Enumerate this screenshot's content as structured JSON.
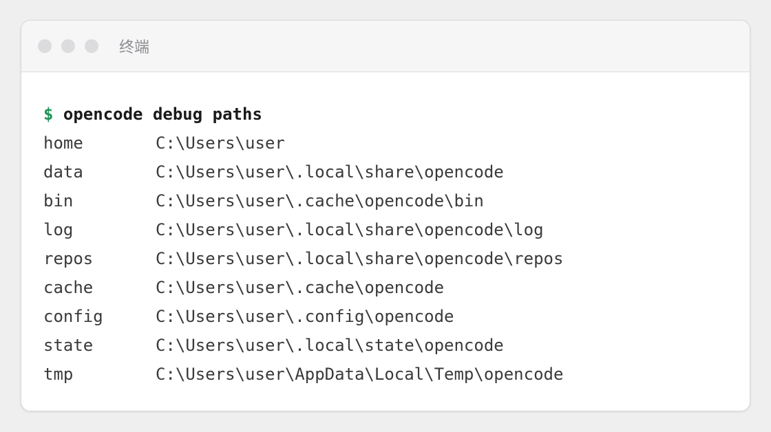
{
  "window": {
    "title": "终端"
  },
  "terminal": {
    "prompt": "$",
    "command": "opencode debug paths",
    "rows": [
      {
        "key": "home",
        "path": "C:\\Users\\user"
      },
      {
        "key": "data",
        "path": "C:\\Users\\user\\.local\\share\\opencode"
      },
      {
        "key": "bin",
        "path": "C:\\Users\\user\\.cache\\opencode\\bin"
      },
      {
        "key": "log",
        "path": "C:\\Users\\user\\.local\\share\\opencode\\log"
      },
      {
        "key": "repos",
        "path": "C:\\Users\\user\\.local\\share\\opencode\\repos"
      },
      {
        "key": "cache",
        "path": "C:\\Users\\user\\.cache\\opencode"
      },
      {
        "key": "config",
        "path": "C:\\Users\\user\\.config\\opencode"
      },
      {
        "key": "state",
        "path": "C:\\Users\\user\\.local\\state\\opencode"
      },
      {
        "key": "tmp",
        "path": "C:\\Users\\user\\AppData\\Local\\Temp\\opencode"
      }
    ]
  },
  "colors": {
    "prompt": "#1f9357",
    "text": "#3a3a3a",
    "command": "#1a1a1a",
    "titlebar": "#f6f6f7",
    "background": "#efeff0"
  }
}
